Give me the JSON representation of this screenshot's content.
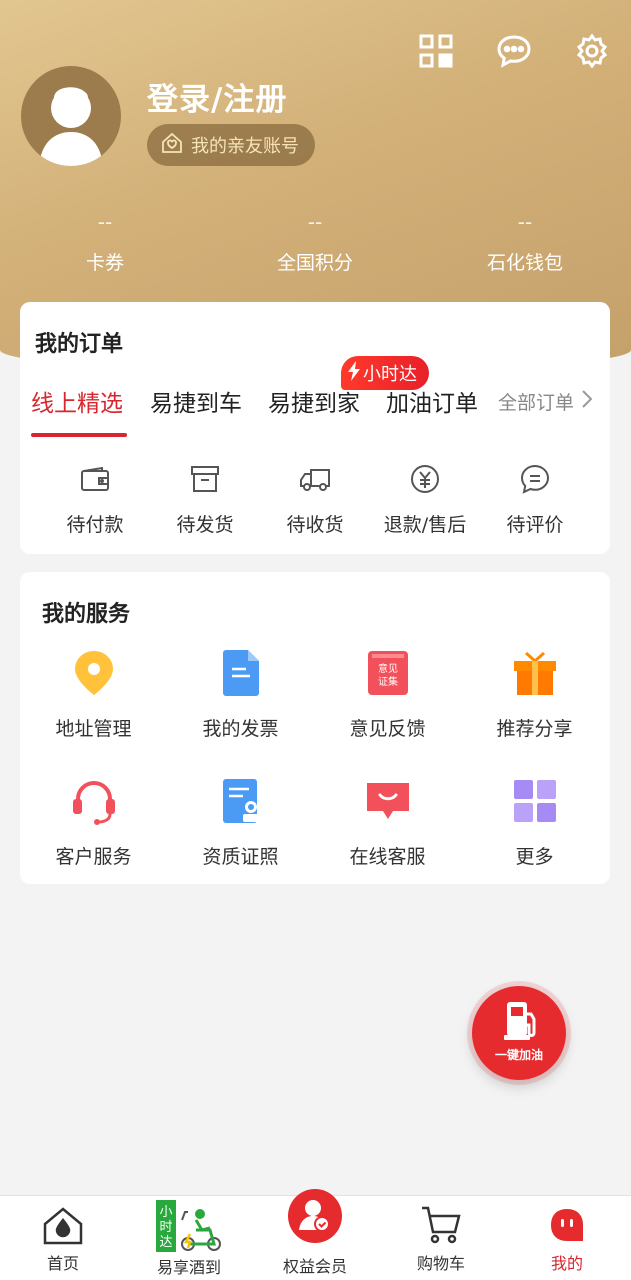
{
  "header": {
    "login_label": "登录/注册",
    "family_account_label": "我的亲友账号",
    "top_icons": [
      "qr-code-icon",
      "message-icon",
      "settings-icon"
    ]
  },
  "stats": [
    {
      "value": "--",
      "label": "卡券"
    },
    {
      "value": "--",
      "label": "全国积分"
    },
    {
      "value": "--",
      "label": "石化钱包"
    }
  ],
  "orders": {
    "title": "我的订单",
    "tabs": [
      {
        "label": "线上精选",
        "active": true
      },
      {
        "label": "易捷到车",
        "active": false
      },
      {
        "label": "易捷到家",
        "active": false
      },
      {
        "label": "加油订单",
        "active": false
      }
    ],
    "badge": "小时达",
    "all_orders_label": "全部订单",
    "items": [
      {
        "label": "待付款",
        "icon": "wallet-icon"
      },
      {
        "label": "待发货",
        "icon": "box-icon"
      },
      {
        "label": "待收货",
        "icon": "truck-icon"
      },
      {
        "label": "退款/售后",
        "icon": "refund-icon"
      },
      {
        "label": "待评价",
        "icon": "comment-icon"
      }
    ]
  },
  "services": {
    "title": "我的服务",
    "items": [
      {
        "label": "地址管理",
        "icon": "location-pin-icon"
      },
      {
        "label": "我的发票",
        "icon": "invoice-icon"
      },
      {
        "label": "意见反馈",
        "icon": "feedback-icon",
        "icon_text": "意见\n证集"
      },
      {
        "label": "推荐分享",
        "icon": "gift-icon"
      },
      {
        "label": "客户服务",
        "icon": "headset-icon"
      },
      {
        "label": "资质证照",
        "icon": "certificate-icon"
      },
      {
        "label": "在线客服",
        "icon": "chat-bubble-icon"
      },
      {
        "label": "更多",
        "icon": "grid-icon"
      }
    ]
  },
  "fab": {
    "label": "一键加油"
  },
  "bottom_nav": [
    {
      "label": "首页",
      "icon": "home-drop-icon",
      "active": false
    },
    {
      "label": "易享酒到",
      "icon": "scooter-icon",
      "badge": "小时达",
      "active": false
    },
    {
      "label": "权益会员",
      "icon": "member-icon",
      "active": false
    },
    {
      "label": "购物车",
      "icon": "cart-icon",
      "active": false
    },
    {
      "label": "我的",
      "icon": "profile-face-icon",
      "active": true
    }
  ],
  "colors": {
    "brand_red": "#d7262e",
    "gold": "#d2b078"
  }
}
